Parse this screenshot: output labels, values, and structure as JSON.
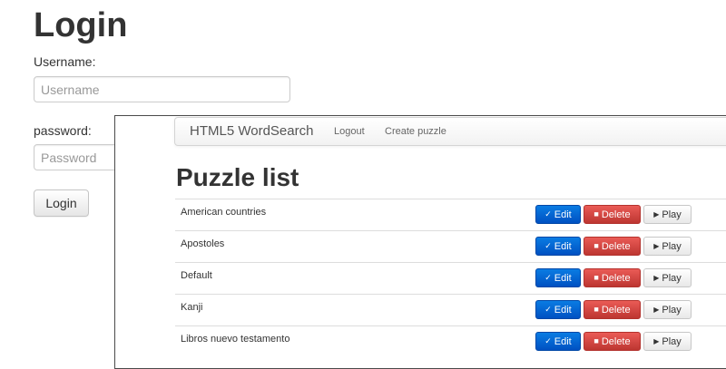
{
  "login": {
    "title": "Login",
    "username_label": "Username:",
    "username_placeholder": "Username",
    "password_label": "password:",
    "password_placeholder": "Password",
    "button_label": "Login"
  },
  "overlay": {
    "brand": "HTML5 WordSearch",
    "nav": {
      "logout": "Logout",
      "create": "Create puzzle"
    },
    "page_title": "Puzzle list",
    "buttons": {
      "edit": "Edit",
      "delete": "Delete",
      "play": "Play"
    },
    "puzzles": [
      "American countries",
      "Apostoles",
      "Default",
      "Kanji",
      "Libros nuevo testamento"
    ]
  }
}
